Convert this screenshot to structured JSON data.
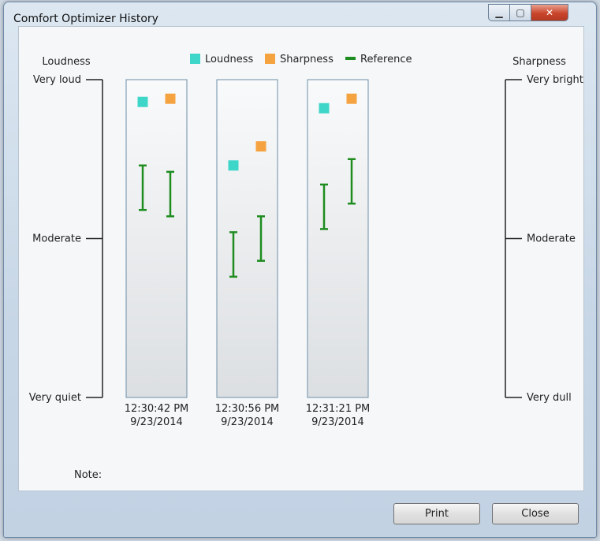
{
  "window": {
    "title": "Comfort Optimizer History",
    "controls": {
      "minimize_icon": "minimize-icon",
      "maximize_icon": "maximize-icon",
      "close_icon": "close-icon"
    }
  },
  "chart_data": {
    "type": "scatter",
    "title": "",
    "legend": {
      "placement": "top",
      "items": [
        {
          "label": "Loudness",
          "color": "#3ed6c8",
          "marker": "square"
        },
        {
          "label": "Sharpness",
          "color": "#f5a340",
          "marker": "square"
        },
        {
          "label": "Reference",
          "color": "#1e8c1e",
          "marker": "line"
        }
      ]
    },
    "left_axis": {
      "title": "Loudness",
      "scale": [
        0,
        100
      ],
      "ticks": [
        {
          "label": "Very loud",
          "value": 100
        },
        {
          "label": "Moderate",
          "value": 50
        },
        {
          "label": "Very quiet",
          "value": 0
        }
      ]
    },
    "right_axis": {
      "title": "Sharpness",
      "scale": [
        0,
        100
      ],
      "ticks": [
        {
          "label": "Very bright",
          "value": 100
        },
        {
          "label": "Moderate",
          "value": 50
        },
        {
          "label": "Very dull",
          "value": 0
        }
      ]
    },
    "sessions": [
      {
        "time": "12:30:42 PM",
        "date": "9/23/2014",
        "loudness": 93,
        "sharpness": 94,
        "loudness_reference": [
          59,
          73
        ],
        "sharpness_reference": [
          57,
          71
        ]
      },
      {
        "time": "12:30:56 PM",
        "date": "9/23/2014",
        "loudness": 73,
        "sharpness": 79,
        "loudness_reference": [
          38,
          52
        ],
        "sharpness_reference": [
          43,
          57
        ]
      },
      {
        "time": "12:31:21 PM",
        "date": "9/23/2014",
        "loudness": 91,
        "sharpness": 94,
        "loudness_reference": [
          53,
          67
        ],
        "sharpness_reference": [
          61,
          75
        ]
      }
    ]
  },
  "note_label": "Note:",
  "buttons": {
    "print": "Print",
    "close": "Close"
  }
}
